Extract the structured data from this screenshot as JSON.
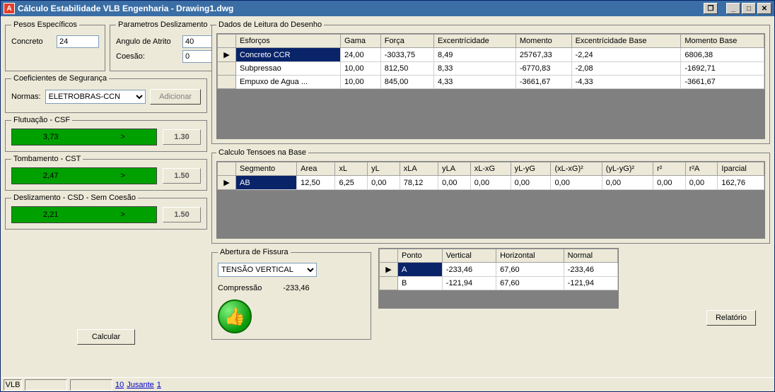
{
  "window": {
    "title": "Cálculo Estabilidade VLB Engenharia - Drawing1.dwg"
  },
  "pesos": {
    "legend": "Pesos Específicos",
    "concreto_label": "Concreto",
    "concreto_value": "24"
  },
  "desliz": {
    "legend": "Parametros Deslizamento",
    "angulo_label": "Angulo de Atrito",
    "angulo_value": "40",
    "coesao_label": "Coesão:",
    "coesao_value": "0"
  },
  "coef": {
    "legend": "Coeficientes de Segurança",
    "normas_label": "Normas:",
    "normas_value": "ELETROBRAS-CCN",
    "adicionar": "Adicionar"
  },
  "csf": {
    "legend": "Flutuação - CSF",
    "value": "3,73",
    "op": ">",
    "target": "1.30"
  },
  "cst": {
    "legend": "Tombamento - CST",
    "value": "2,47",
    "op": ">",
    "target": "1.50"
  },
  "csd": {
    "legend": "Deslizamento - CSD - Sem Coesão",
    "value": "2,21",
    "op": ">",
    "target": "1.50"
  },
  "calcular": "Calcular",
  "dados": {
    "legend": "Dados de Leitura do Desenho",
    "headers": [
      "",
      "Esforços",
      "Gama",
      "Força",
      "Excentrícidade",
      "Momento",
      "Excentrícidade Base",
      "Momento Base"
    ],
    "rows": [
      {
        "sel": true,
        "cells": [
          "Concreto CCR",
          "24,00",
          "-3033,75",
          "8,49",
          "25767,33",
          "-2,24",
          "6806,38"
        ]
      },
      {
        "sel": false,
        "cells": [
          "Subpressao",
          "10,00",
          "812,50",
          "8,33",
          "-6770,83",
          "-2,08",
          "-1692,71"
        ]
      },
      {
        "sel": false,
        "cells": [
          "Empuxo de Agua ...",
          "10,00",
          "845,00",
          "4,33",
          "-3661,67",
          "-4,33",
          "-3661,67"
        ]
      }
    ]
  },
  "tensoes": {
    "legend": "Calculo Tensoes na Base",
    "headers": [
      "",
      "Segmento",
      "Area",
      "xL",
      "yL",
      "xLA",
      "yLA",
      "xL-xG",
      "yL-yG",
      "(xL-xG)²",
      "(yL-yG)²",
      "r²",
      "r²A",
      "Iparcial"
    ],
    "rows": [
      {
        "sel": true,
        "cells": [
          "AB",
          "12,50",
          "6,25",
          "0,00",
          "78,12",
          "0,00",
          "0,00",
          "0,00",
          "0,00",
          "0,00",
          "0,00",
          "0,00",
          "162,76"
        ]
      }
    ]
  },
  "fissura": {
    "legend": "Abertura de Fissura",
    "select_value": "TENSÃO VERTICAL",
    "compressao_label": "Compressão",
    "compressao_value": "-233,46"
  },
  "pontos": {
    "headers": [
      "",
      "Ponto",
      "Vertical",
      "Horizontal",
      "Normal"
    ],
    "rows": [
      {
        "sel": true,
        "cells": [
          "A",
          "-233,46",
          "67,60",
          "-233,46"
        ]
      },
      {
        "sel": false,
        "cells": [
          "B",
          "-121,94",
          "67,60",
          "-121,94"
        ]
      }
    ]
  },
  "relatorio": "Relatório",
  "status": {
    "vlb": "VLB",
    "n10": "10",
    "jusante": "Jusante",
    "n1": "1"
  }
}
